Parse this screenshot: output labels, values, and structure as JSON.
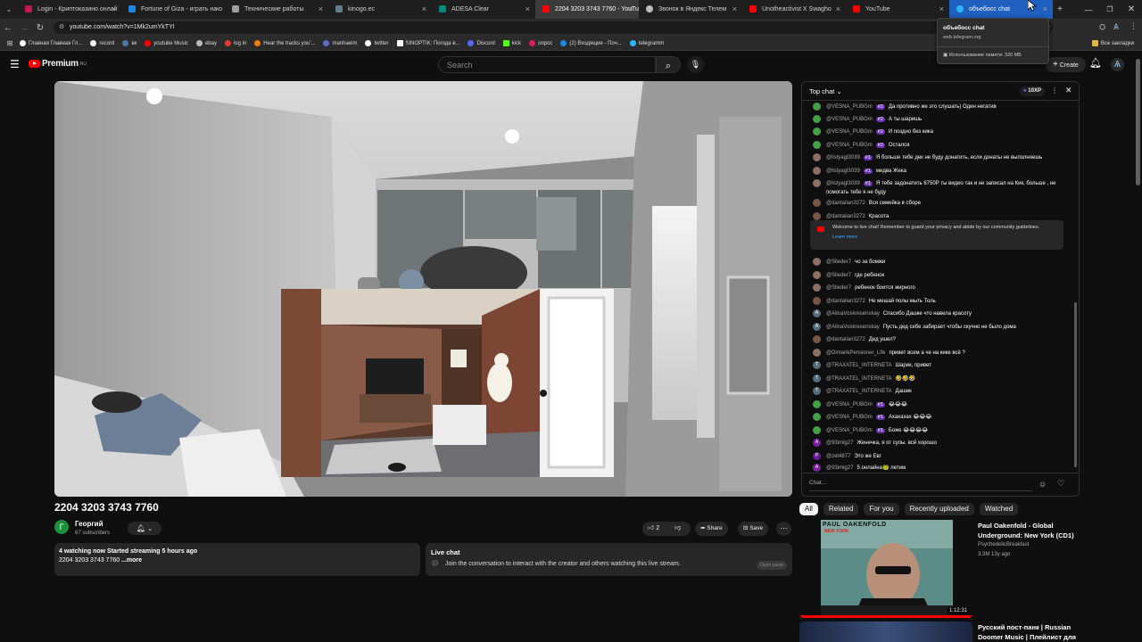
{
  "browser": {
    "tabs": [
      {
        "label": "Login - Криптоказино онлай",
        "color": "#c2185b"
      },
      {
        "label": "Fortune of Giza - играть на о",
        "color": "#1e88e5"
      },
      {
        "label": "Технические работы",
        "color": "#9e9e9e"
      },
      {
        "label": "kinogo.ec",
        "color": "#607d8b"
      },
      {
        "label": "ADESA Clear",
        "color": "#00897b"
      },
      {
        "label": "2204 3203 3743 7760 - YouTu",
        "color": "#ff0000"
      },
      {
        "label": "Звонок в Яндекс Телем",
        "color": "#bbbbbb"
      },
      {
        "label": "Unotheactivist X Swagho",
        "color": "#ff0000"
      },
      {
        "label": "YouTube",
        "color": "#ff0000"
      },
      {
        "label": "объебосс chat",
        "color": "#29b6f6"
      }
    ],
    "url": "youtube.com/watch?v=1Mk2umYkTYI",
    "bookmarks": [
      {
        "label": "Главная Главная Гл...",
        "color": "#ffffff"
      },
      {
        "label": "record",
        "color": "#ffffff"
      },
      {
        "label": "вк",
        "color": "#4a76a8"
      },
      {
        "label": "youtube Music",
        "color": "#ff0000"
      },
      {
        "label": "ebay",
        "color": "#bbbbbb"
      },
      {
        "label": "log in",
        "color": "#e53935"
      },
      {
        "label": "Hear the tracks you'...",
        "color": "#f57c00"
      },
      {
        "label": "manhaeim",
        "color": "#5c6bc0"
      },
      {
        "label": "twitter",
        "color": "#ffffff"
      },
      {
        "label": "SINOPTIK: Погода в...",
        "color": "#ffffff"
      },
      {
        "label": "Discord",
        "color": "#5865f2"
      },
      {
        "label": "kick",
        "color": "#53fc18"
      },
      {
        "label": "опрос",
        "color": "#d81b60"
      },
      {
        "label": "(2) Входящие - Поч...",
        "color": "#1e88e5"
      },
      {
        "label": "telegramm",
        "color": "#29b6f6"
      }
    ],
    "all_bookmarks": "Все закладки",
    "popup": {
      "title": "объебосс chat",
      "domain": "web.telegram.org",
      "memory": "Использование памяти: 320 МБ"
    }
  },
  "youtube": {
    "logo_text": "Premium",
    "logo_region": "RU",
    "search_placeholder": "Search",
    "create_label": "Create"
  },
  "video": {
    "title": "2204 3203 3743 7760",
    "channel": "Георгий",
    "channel_initial": "Г",
    "subscribers": "67 subscribers",
    "likes": "2",
    "share_label": "Share",
    "save_label": "Save",
    "desc_stats": "4 watching now  Started streaming 5 hours ago",
    "desc_text": "2204 3203 3743 7760",
    "desc_more": "...more",
    "livechat_title": "Live chat",
    "livechat_text": "Join the conversation to interact with the creator and others watching this live stream.",
    "open_panel": "Open panel"
  },
  "chat": {
    "header": "Top chat",
    "xp": "10XP",
    "input_placeholder": "Chat...",
    "welcome_text": "Welcome to live chat! Remember to guard your privacy and abide by our community guidelines.",
    "learn_more": "Learn more",
    "messages": [
      {
        "author": "@VESNA_PUBGm",
        "badge": "#2",
        "text": "Да противно же это слушать) Один негатив",
        "color": "#43a047"
      },
      {
        "author": "@VESNA_PUBGm",
        "badge": "#2",
        "text": "А ты шаришь",
        "color": "#43a047"
      },
      {
        "author": "@VESNA_PUBGm",
        "badge": "#2",
        "text": "И поздно без кика",
        "color": "#43a047"
      },
      {
        "author": "@VESNA_PUBGm",
        "badge": "#2",
        "text": "Остался",
        "color": "#43a047"
      },
      {
        "author": "@listyagl3039",
        "badge": "#1",
        "text": "Я больше тебе дек не буду донатить, если донаты не выполняешь",
        "color": "#8d6e63"
      },
      {
        "author": "@listyagl3039",
        "badge": "#1",
        "text": "мидва Жека",
        "color": "#8d6e63"
      },
      {
        "author": "@listyagl3039",
        "badge": "#1",
        "text": "Я тебе задонатить 6750Р ты видео так и не записал на Кик, больше , не",
        "text2": "помогать тебе я не буду",
        "color": "#8d6e63"
      },
      {
        "author": "@dantalian3272",
        "badge": "",
        "text": "Вся семейка в сборе",
        "color": "#795548"
      },
      {
        "author": "@dantalian3272",
        "badge": "",
        "text": "Красота",
        "color": "#795548"
      },
      {
        "author": "@Slieder7",
        "badge": "",
        "text": "чо за бомжи",
        "color": "#8d6e63"
      },
      {
        "author": "@Slieder7",
        "badge": "",
        "text": "где ребенок",
        "color": "#8d6e63"
      },
      {
        "author": "@Slieder7",
        "badge": "",
        "text": "ребенок боится жирного",
        "color": "#8d6e63"
      },
      {
        "author": "@dantalian3272",
        "badge": "",
        "text": "Не мешай полы мыть Толь",
        "color": "#795548"
      },
      {
        "author": "@AlinaVoskresenskay",
        "badge": "",
        "text": "Спасибо Дашке что навела красоту",
        "color": "#546e7a",
        "initial": "A"
      },
      {
        "author": "@AlinaVoskresenskay",
        "badge": "",
        "text": "Пусть дед себе забирает чтобы скучно не было дома",
        "color": "#546e7a",
        "initial": "A"
      },
      {
        "author": "@dantalian3272",
        "badge": "",
        "text": "Дед ушел?",
        "color": "#795548"
      },
      {
        "author": "@DimarikPensioner_Life",
        "badge": "",
        "text": "привет всем а че на кике всё ?",
        "color": "#8d6e63"
      },
      {
        "author": "@TRAXATEL_INTERNETA",
        "badge": "",
        "text": "Шарик, привет",
        "color": "#546e7a",
        "initial": "T"
      },
      {
        "author": "@TRAXATEL_INTERNETA",
        "badge": "",
        "text": "🤣🤣🤣",
        "color": "#546e7a",
        "initial": "T"
      },
      {
        "author": "@TRAXATEL_INTERNETA",
        "badge": "",
        "text": "Дашик",
        "color": "#546e7a",
        "initial": "T"
      },
      {
        "author": "@VESNA_PUBGm",
        "badge": "#1",
        "text": "😂😂😂",
        "color": "#43a047"
      },
      {
        "author": "@VESNA_PUBGm",
        "badge": "#1",
        "text": "Ахахахах 😂😂😂",
        "color": "#43a047"
      },
      {
        "author": "@VESNA_PUBGm",
        "badge": "#1",
        "text": "Боже 😂😂😂😂",
        "color": "#43a047"
      },
      {
        "author": "@93imlg27",
        "badge": "",
        "text": "Женечка, я от супы. всё хорошо",
        "color": "#7b1fa2",
        "initial": "A"
      },
      {
        "author": "@zet4877",
        "badge": "",
        "text": "Это же Евг",
        "color": "#6a1b9a",
        "initial": "P"
      },
      {
        "author": "@93imlg27",
        "badge": "",
        "text": "5 онлайна🐸 летим",
        "color": "#7b1fa2",
        "initial": "A"
      }
    ]
  },
  "related": {
    "chips": [
      "All",
      "Related",
      "For you",
      "Recently uploaded",
      "Watched"
    ],
    "items": [
      {
        "title": "Paul Oakenfold - Global Underground: New York (CD1)",
        "channel": "PsychedelicBreakfast",
        "meta": "3.3M  13y ago",
        "duration": "1:12:31",
        "thumb_title": "PAUL OAKENFOLD",
        "thumb_sub": "NEW YORK"
      },
      {
        "title": "Русский пост-панк | Russian Doomer Music | Плейлист для",
        "channel": "",
        "meta": "",
        "duration": ""
      }
    ]
  }
}
